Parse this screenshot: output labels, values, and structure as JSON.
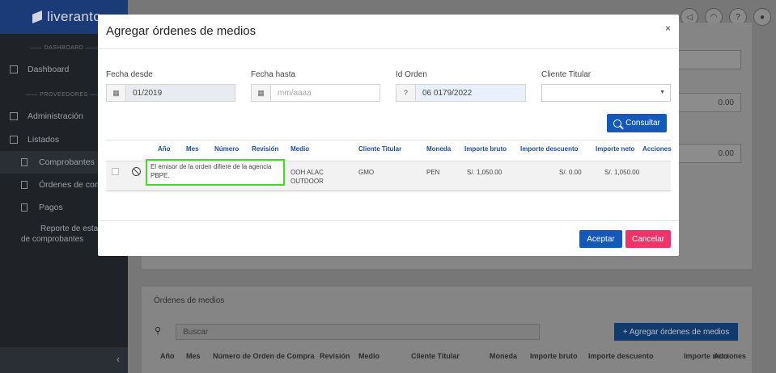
{
  "sidebar": {
    "logo": "liveranto",
    "section_dashboard": "DASHBOARD",
    "dashboard": "Dashboard",
    "section_proveedores": "PROVEEDORES",
    "administracion": "Administración",
    "listados": "Listados",
    "comprobantes": "Comprobantes",
    "ordenes": "Órdenes de com",
    "pagos": "Pagos",
    "reporte_l1": "Reporte de esta",
    "reporte_l2": "de comprobantes",
    "collapse": "‹"
  },
  "background": {
    "field1_value": "0.00",
    "field2_value": "0.00",
    "section_title": "Órdenes de medios",
    "search_placeholder": "Buscar",
    "add_button": "+  Agregar órdenes de medios",
    "columns": [
      "Año",
      "Mes",
      "Número de Orden de Compra",
      "Revisión",
      "Medio",
      "Cliente Titular",
      "Moneda",
      "Importe bruto",
      "Importe descuento",
      "Importe neto",
      "Acciones"
    ]
  },
  "modal": {
    "title": "Agregar órdenes de medios",
    "close": "×",
    "fecha_desde_label": "Fecha desde",
    "fecha_desde_value": "01/2019",
    "fecha_hasta_label": "Fecha hasta",
    "fecha_hasta_placeholder": "mm/aaaa",
    "id_orden_label": "Id Orden",
    "id_orden_value": "06 0179/2022",
    "cliente_label": "Cliente Titular",
    "consultar": "Consultar",
    "columns": {
      "anio": "Año",
      "mes": "Mes",
      "numero": "Número",
      "revision": "Revisión",
      "medio": "Medio",
      "cliente": "Cliente Titular",
      "moneda": "Moneda",
      "bruto": "Importe bruto",
      "descuento": "Importe descuento",
      "neto": "Importe neto",
      "acciones": "Acciones"
    },
    "row": {
      "tooltip": "El emisor de la orden difiere de la agencia PBPE.",
      "medio_l1": "OOH ALAC",
      "medio_l2": "OUTDOOR",
      "cliente": "GMO",
      "moneda": "PEN",
      "bruto": "S/. 1,050.00",
      "descuento": "S/. 0.00",
      "neto": "S/. 1,050.00"
    },
    "aceptar": "Aceptar",
    "cancelar": "Cancelar"
  },
  "colors": {
    "primary": "#1458b9",
    "danger": "#f2336a",
    "highlight": "#3ce01f",
    "header_text": "#1a4fa0"
  }
}
